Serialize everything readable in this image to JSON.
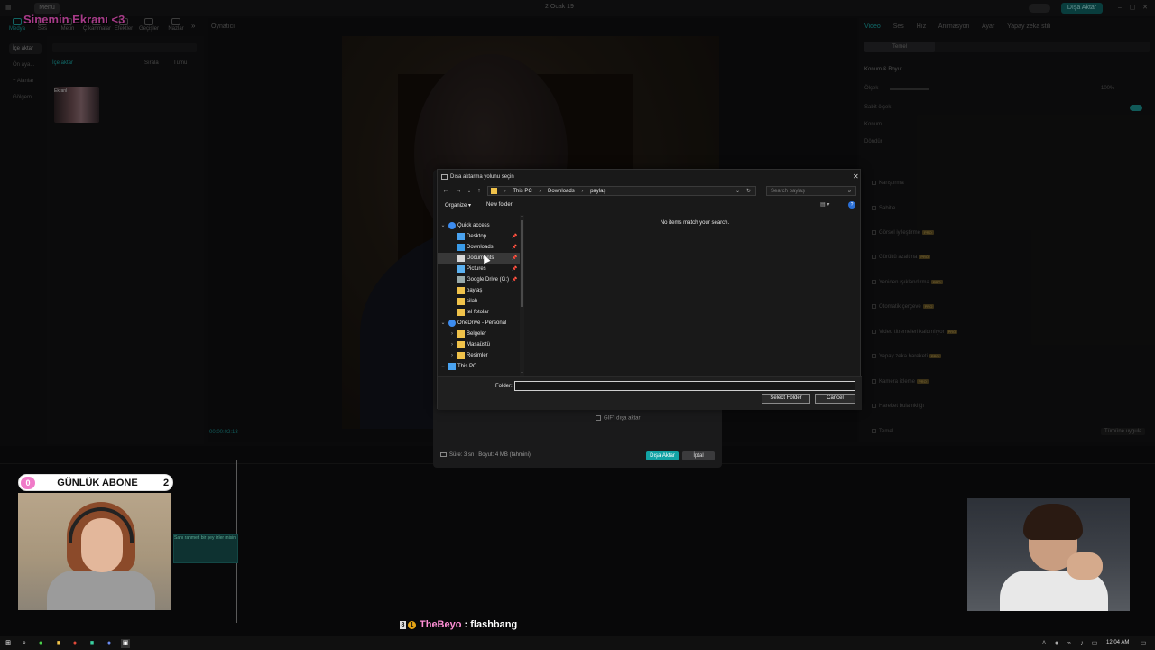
{
  "app": {
    "menu_label": "Menü",
    "date_title": "2 Ocak 19",
    "export_chip": "Dışa Aktar",
    "overlay_title": "Sinemin Ekranı <3"
  },
  "toolbar": {
    "items": [
      "Medya",
      "Ses",
      "Metin",
      "Çıkartmalar",
      "Efektler",
      "Geçişler",
      "Nazlar"
    ]
  },
  "left_nav": {
    "items": [
      "İçe aktar",
      "Ön aya...",
      "+ Alanlar",
      "Gölgem..."
    ]
  },
  "media_panel": {
    "import_label": "İçe aktar",
    "filter_label": "Tümü",
    "sort_label": "Sırala",
    "thumb_caption": "Ekranl"
  },
  "player": {
    "label": "Oynatıcı",
    "timecode": "00:00:02:13"
  },
  "right_panel": {
    "tabs": [
      "Video",
      "Ses",
      "Hız",
      "Animasyon",
      "Ayar",
      "Yapay zeka stili"
    ],
    "subtab": "Temel",
    "section": "Konum & Boyut",
    "scale_label": "Ölçek",
    "scale_value": "100%",
    "uniform_scale": "Sabit ölçek",
    "position_label": "Konum",
    "rotate_label": "Döndür",
    "options": [
      {
        "label": "Karıştırma",
        "pro": false
      },
      {
        "label": "Sabitle",
        "pro": false
      },
      {
        "label": "Görsel iyileştirme",
        "pro": true
      },
      {
        "label": "Gürültü azaltma",
        "pro": true
      },
      {
        "label": "Yeniden ışıklandırma",
        "pro": true
      },
      {
        "label": "Otomatik çerçeve",
        "pro": true
      },
      {
        "label": "Video titremeleri kaldırılıyor",
        "pro": true
      },
      {
        "label": "Yapay zeka hareketi",
        "pro": true
      },
      {
        "label": "Kamera izleme",
        "pro": true
      },
      {
        "label": "Hareket bulanıklığı",
        "pro": false
      },
      {
        "label": "Temel",
        "pro": false
      }
    ],
    "pro_badge": "PRO",
    "apply_all": "Tümüne uygula"
  },
  "timeline": {
    "clip_label": "Sanı rahmeti bir şey izler misin"
  },
  "export_dialog": {
    "gif_label": "GIF'i dışa aktar",
    "info": "Süre: 3 sn | Boyut: 4 MB (tahmini)",
    "export_button": "Dışa Aktar",
    "cancel_button": "İptal"
  },
  "picker": {
    "title": "Dışa aktarma yolunu seçin",
    "path": [
      "This PC",
      "Downloads",
      "paylaş"
    ],
    "search_placeholder": "Search paylaş",
    "organize": "Organize",
    "new_folder": "New folder",
    "empty_message": "No items match your search.",
    "folder_label": "Folder:",
    "folder_value": "",
    "select_button": "Select Folder",
    "cancel_button": "Cancel",
    "nav": [
      {
        "label": "Quick access",
        "icon": "star-icon",
        "level": 0,
        "expanded": true,
        "pinned": false,
        "selected": false,
        "color": "#3c8cf0"
      },
      {
        "label": "Desktop",
        "icon": "desktop-icon",
        "level": 1,
        "expanded": null,
        "pinned": true,
        "selected": false,
        "color": "#4aa3f0"
      },
      {
        "label": "Downloads",
        "icon": "download-icon",
        "level": 1,
        "expanded": null,
        "pinned": true,
        "selected": false,
        "color": "#3a9be8"
      },
      {
        "label": "Documents",
        "icon": "document-icon",
        "level": 1,
        "expanded": null,
        "pinned": true,
        "selected": true,
        "color": "#d8d8d8"
      },
      {
        "label": "Pictures",
        "icon": "pictures-icon",
        "level": 1,
        "expanded": null,
        "pinned": true,
        "selected": false,
        "color": "#5ab0f0"
      },
      {
        "label": "Google Drive (G:)",
        "icon": "drive-icon",
        "level": 1,
        "expanded": null,
        "pinned": true,
        "selected": false,
        "color": "#9aa"
      },
      {
        "label": "paylaş",
        "icon": "folder-icon",
        "level": 1,
        "expanded": null,
        "pinned": false,
        "selected": false,
        "color": "#f0c24a"
      },
      {
        "label": "silah",
        "icon": "folder-icon",
        "level": 1,
        "expanded": null,
        "pinned": false,
        "selected": false,
        "color": "#f0c24a"
      },
      {
        "label": "tel fotolar",
        "icon": "folder-icon",
        "level": 1,
        "expanded": null,
        "pinned": false,
        "selected": false,
        "color": "#f0c24a"
      },
      {
        "label": "OneDrive - Personal",
        "icon": "cloud-icon",
        "level": 0,
        "expanded": true,
        "pinned": false,
        "selected": false,
        "color": "#3c8cf0"
      },
      {
        "label": "Belgeler",
        "icon": "folder-icon",
        "level": 1,
        "expanded": false,
        "pinned": false,
        "selected": false,
        "color": "#f0c24a"
      },
      {
        "label": "Masaüstü",
        "icon": "folder-icon",
        "level": 1,
        "expanded": false,
        "pinned": false,
        "selected": false,
        "color": "#f0c24a"
      },
      {
        "label": "Resimler",
        "icon": "folder-icon",
        "level": 1,
        "expanded": false,
        "pinned": false,
        "selected": false,
        "color": "#f0c24a"
      },
      {
        "label": "This PC",
        "icon": "pc-icon",
        "level": 0,
        "expanded": true,
        "pinned": false,
        "selected": false,
        "color": "#4aa3f0"
      }
    ]
  },
  "stream": {
    "sub_banner": {
      "left": "0",
      "title": "GÜNLÜK ABONE",
      "right": "2"
    },
    "chat": {
      "badge1": "8",
      "badge2": "1",
      "user": "TheBeyo",
      "message": " : flashbang"
    }
  },
  "taskbar": {
    "time": "12:04 AM"
  }
}
